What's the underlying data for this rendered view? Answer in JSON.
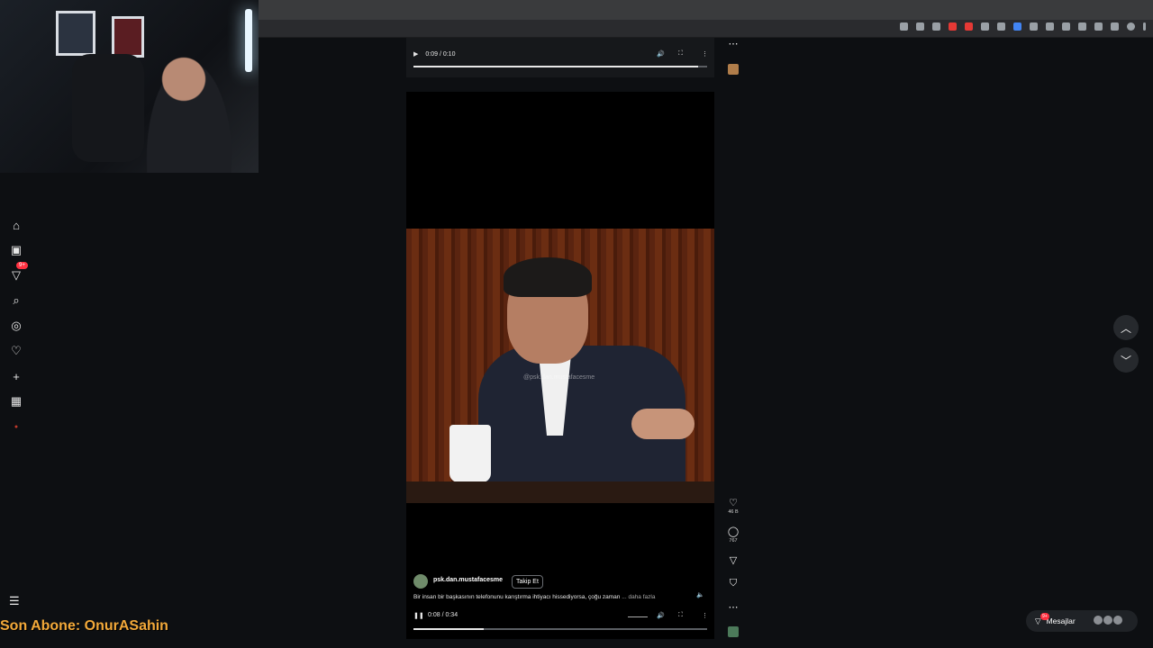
{
  "top_video": {
    "time": "0:09 / 0:10",
    "progress": 0.97
  },
  "main_video": {
    "watermark": "@psk.dan.mustafacesme",
    "username": "psk.dan.mustafacesme",
    "follow_label": "Takip Et",
    "caption": "Bir insan bir başkasının telefonunu karıştırma ihtiyacı hissediyorsa, çoğu zaman",
    "more_label": "... daha fazla",
    "time": "0:08 / 0:34",
    "progress": 0.24
  },
  "actions": {
    "likes": "46 B",
    "comments": "767"
  },
  "sidebar": {
    "notification_badge": "9+"
  },
  "messages": {
    "label": "Mesajlar",
    "badge": "9+"
  },
  "overlay": {
    "text": "Son Abone: OnurASahin"
  },
  "colors": {
    "accent_orange": "#f3a93a",
    "badge_red": "#ff3040",
    "background": "#0d0f12"
  }
}
